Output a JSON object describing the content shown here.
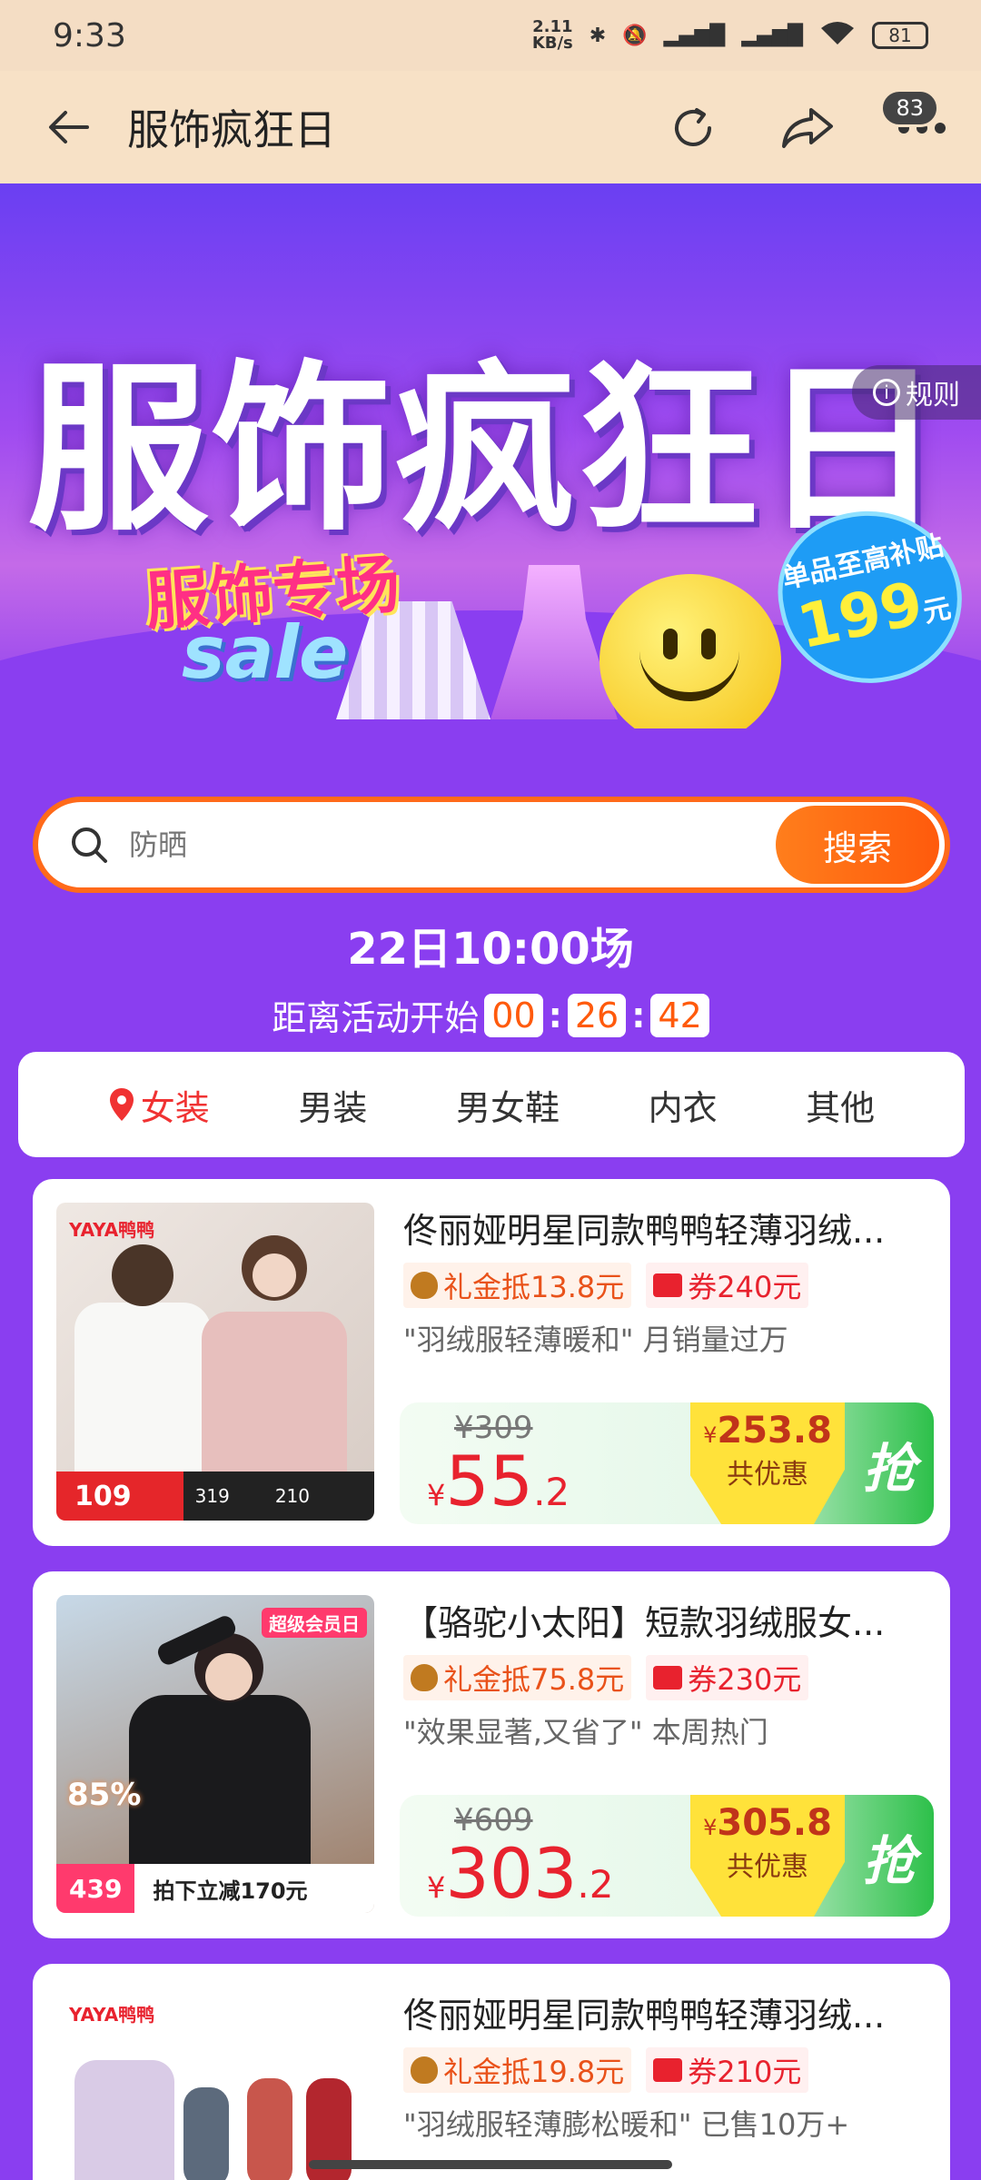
{
  "status_bar": {
    "time": "9:33",
    "speed_top": "2.11",
    "speed_bottom": "KB/s",
    "battery": "81"
  },
  "header": {
    "title": "服饰疯狂日",
    "badge_count": "83"
  },
  "banner": {
    "headline": "服饰疯狂日",
    "sub_headline": "服饰专场",
    "sale_text": "sale",
    "rules_label": "规则",
    "subsidy_line1": "单品至高补贴",
    "subsidy_amount": "199",
    "subsidy_unit": "元"
  },
  "search": {
    "placeholder": "防晒",
    "button_label": "搜索"
  },
  "session": {
    "title": "22日10:00场",
    "countdown_label": "距离活动开始",
    "hours": "00",
    "minutes": "26",
    "seconds": "42"
  },
  "tabs": [
    {
      "label": "女装",
      "active": true
    },
    {
      "label": "男装",
      "active": false
    },
    {
      "label": "男女鞋",
      "active": false
    },
    {
      "label": "内衣",
      "active": false
    },
    {
      "label": "其他",
      "active": false
    }
  ],
  "products": [
    {
      "brand": "YAYA鸭鸭",
      "title": "佟丽娅明星同款鸭鸭轻薄羽绒...",
      "cash_tag": "礼金抵13.8元",
      "coupon_tag": "券240元",
      "quote": "\"羽绒服轻薄暖和\" 月销量过万",
      "original_price": "¥309",
      "price_currency": "¥",
      "price_int": "55",
      "price_dec": ".2",
      "save_currency": "¥",
      "save_amount": "253.8",
      "save_label": "共优惠",
      "grab_label": "抢",
      "img_price": "109",
      "img_note1": "319",
      "img_note2": "210"
    },
    {
      "brand": "超级会员日",
      "title": "【骆驼小太阳】短款羽绒服女...",
      "cash_tag": "礼金抵75.8元",
      "coupon_tag": "券230元",
      "quote": "\"效果显著,又省了\" 本周热门",
      "original_price": "¥609",
      "price_currency": "¥",
      "price_int": "303",
      "price_dec": ".2",
      "save_currency": "¥",
      "save_amount": "305.8",
      "save_label": "共优惠",
      "grab_label": "抢",
      "img_price": "439",
      "img_note1": "拍下立减170元",
      "img_note2": "85%"
    },
    {
      "brand": "YAYA鸭鸭",
      "title": "佟丽娅明星同款鸭鸭轻薄羽绒...",
      "cash_tag": "礼金抵19.8元",
      "coupon_tag": "券210元",
      "quote": "\"羽绒服轻薄膨松暖和\" 已售10万+"
    }
  ],
  "colors": {
    "page_bg": "#8a3ef0",
    "accent_orange": "#ff6a1a",
    "price_red": "#e8222e",
    "tab_active": "#f03232"
  }
}
